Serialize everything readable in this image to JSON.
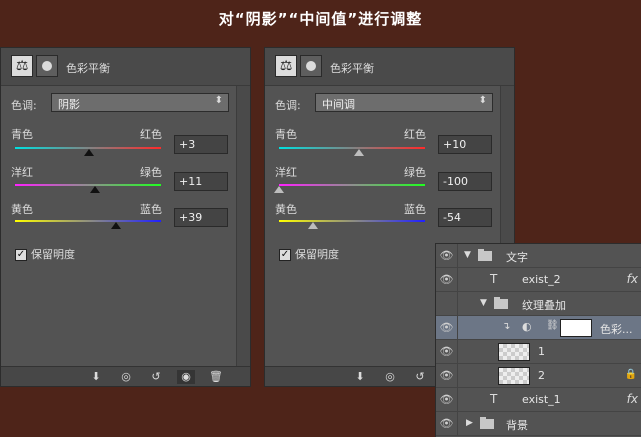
{
  "banner": "对“阴影”“中间值”进行调整",
  "left_panel": {
    "title": "色彩平衡",
    "tone_label": "色调:",
    "tone_value": "阴影",
    "sliders": [
      {
        "left": "青色",
        "right": "红色",
        "value": "+3",
        "position": 0.51
      },
      {
        "left": "洋红",
        "right": "绿色",
        "value": "+11",
        "position": 0.55
      },
      {
        "left": "黄色",
        "right": "蓝色",
        "value": "+39",
        "position": 0.69
      }
    ],
    "preserve_label": "保留明度"
  },
  "right_panel": {
    "title": "色彩平衡",
    "tone_label": "色调:",
    "tone_value": "中间调",
    "sliders": [
      {
        "left": "青色",
        "right": "红色",
        "value": "+10",
        "position": 0.55
      },
      {
        "left": "洋红",
        "right": "绿色",
        "value": "-100",
        "position": 0.0
      },
      {
        "left": "黄色",
        "right": "蓝色",
        "value": "-54",
        "position": 0.23
      }
    ],
    "preserve_label": "保留明度"
  },
  "layers": [
    {
      "name": "文字",
      "type": "group"
    },
    {
      "name": "exist_2",
      "type": "text",
      "fx": "fx"
    },
    {
      "name": "纹理叠加",
      "type": "group"
    },
    {
      "name": "色彩...",
      "type": "adjustment",
      "selected": true
    },
    {
      "name": "1",
      "type": "layer"
    },
    {
      "name": "2",
      "type": "layer",
      "locked": true
    },
    {
      "name": "exist_1",
      "type": "text",
      "fx": "fx"
    },
    {
      "name": "背景",
      "type": "group"
    }
  ],
  "icons": {
    "balance": "balance-scale-icon",
    "mask": "layer-mask-icon",
    "eye": "eye-icon",
    "text_layer": "text-layer-icon",
    "folder": "folder-icon",
    "link": "chain-link-icon",
    "lock": "lock-icon"
  },
  "colors": {
    "background": "#4e2419",
    "panel": "#535353",
    "selected_row": "#6c7686"
  }
}
